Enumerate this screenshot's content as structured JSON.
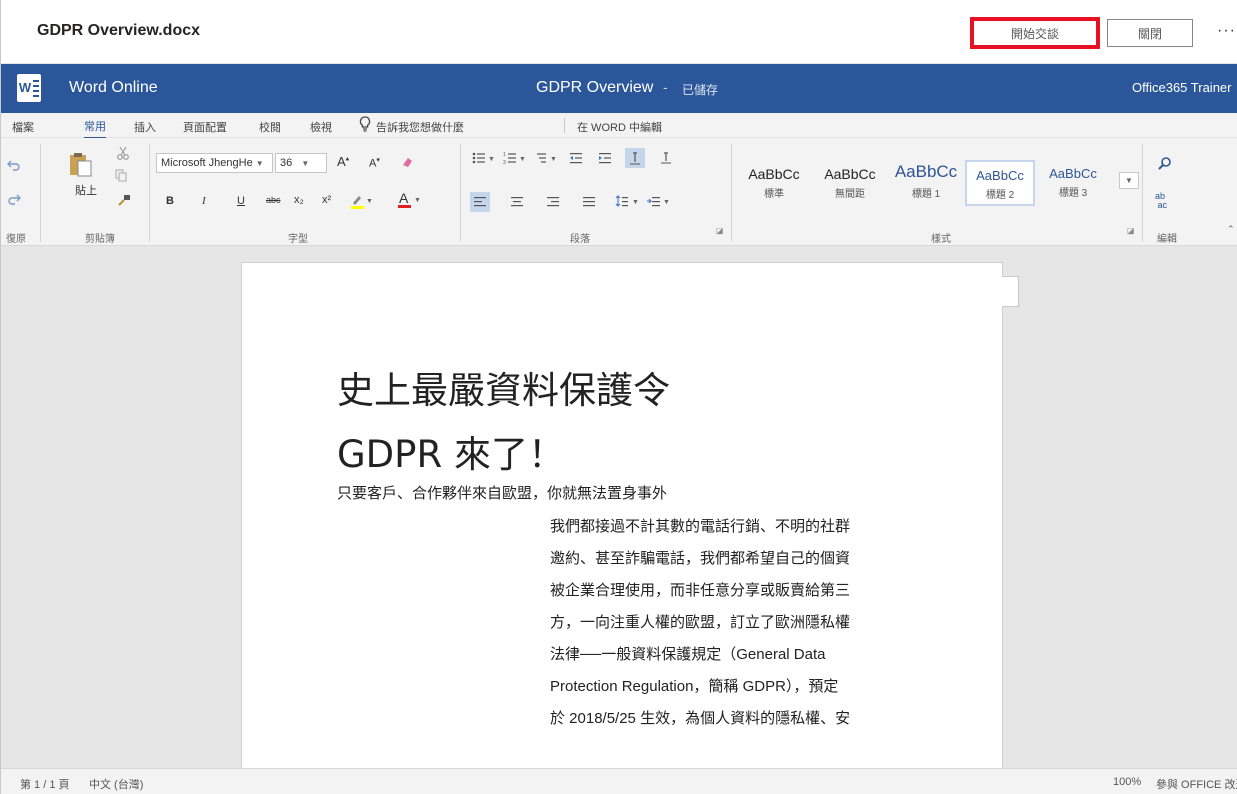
{
  "header": {
    "file_title": "GDPR Overview.docx",
    "start_chat_label": "開始交談",
    "close_label": "關閉",
    "more_label": "···"
  },
  "word_bar": {
    "app_name": "Word Online",
    "doc_name": "GDPR Overview",
    "separator": "-",
    "save_status": "已儲存",
    "user_name": "Office365 Trainer"
  },
  "tabs": {
    "items": [
      "檔案",
      "常用",
      "插入",
      "頁面配置",
      "校閱",
      "檢視"
    ],
    "active": "常用",
    "tell_me": "告訴我您想做什麼",
    "edit_in_word": "在 WORD 中編輯"
  },
  "ribbon": {
    "undo_label": "復原",
    "paste_label": "貼上",
    "clipboard_label": "剪貼簿",
    "font_name": "Microsoft JhengHe",
    "font_size": "36",
    "font_label": "字型",
    "paragraph_label": "段落",
    "styles_label": "樣式",
    "editing_label": "編輯",
    "styles": [
      {
        "preview": "AaBbCc",
        "name": "標準"
      },
      {
        "preview": "AaBbCc",
        "name": "無間距"
      },
      {
        "preview": "AaBbCc",
        "name": "標題 1"
      },
      {
        "preview": "AaBbCc",
        "name": "標題 2"
      },
      {
        "preview": "AaBbCc",
        "name": "標題 3"
      }
    ],
    "selected_style": "標題 2",
    "format_buttons": {
      "bold": "B",
      "italic": "I",
      "underline": "U",
      "strike": "abc",
      "subscript": "x₂",
      "superscript": "x²",
      "font_color": "A"
    }
  },
  "document": {
    "title_line1": "史上最嚴資料保護令",
    "title_line2": "GDPR 來了！",
    "subtitle": "只要客戶、合作夥伴來自歐盟，你就無法置身事外",
    "body_lines": [
      "我們都接過不計其數的電話行銷、不明的社群",
      "邀約、甚至詐騙電話，我們都希望自己的個資",
      "被企業合理使用，而非任意分享或販賣給第三",
      "方，一向注重人權的歐盟，訂立了歐洲隱私權",
      "法律──一般資料保護規定（General Data",
      "Protection Regulation，簡稱 GDPR），預定",
      "於 2018/5/25 生效，為個人資料的隱私權、安"
    ]
  },
  "status_bar": {
    "page_info": "第 1 / 1 頁",
    "language": "中文 (台灣)",
    "zoom": "100%",
    "feedback": "參與 OFFICE 改進"
  },
  "colors": {
    "word_blue": "#2b579a",
    "highlight_red": "#e81123"
  }
}
